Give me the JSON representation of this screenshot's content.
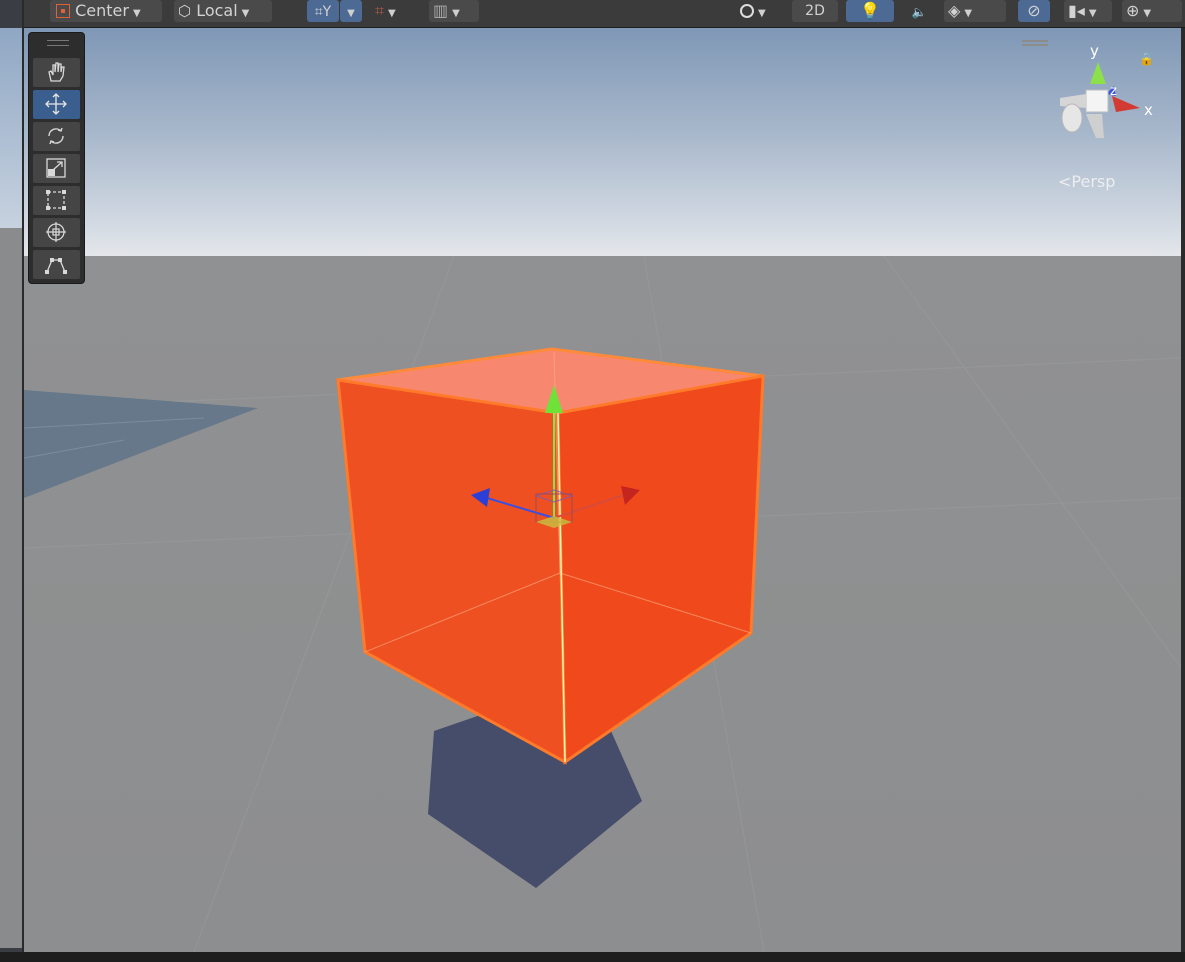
{
  "toolbar": {
    "pivot_label": "Center",
    "rotation_label": "Local",
    "mode_2d_label": "2D"
  },
  "tools": [
    "hand-tool",
    "move-tool",
    "rotate-tool",
    "scale-tool",
    "rect-tool",
    "transform-tool",
    "custom-editor-tool"
  ],
  "scene_gizmo": {
    "axis_x": "x",
    "axis_y": "y",
    "axis_z": "z",
    "projection_label": "Persp"
  },
  "colors": {
    "selected_cube": "#f4501f",
    "cube_outline": "#ff7a2a",
    "x_axis": "#d02b24",
    "y_axis": "#6fe23a",
    "z_axis": "#2b3fd6",
    "active_tool": "#3a5f8f"
  }
}
